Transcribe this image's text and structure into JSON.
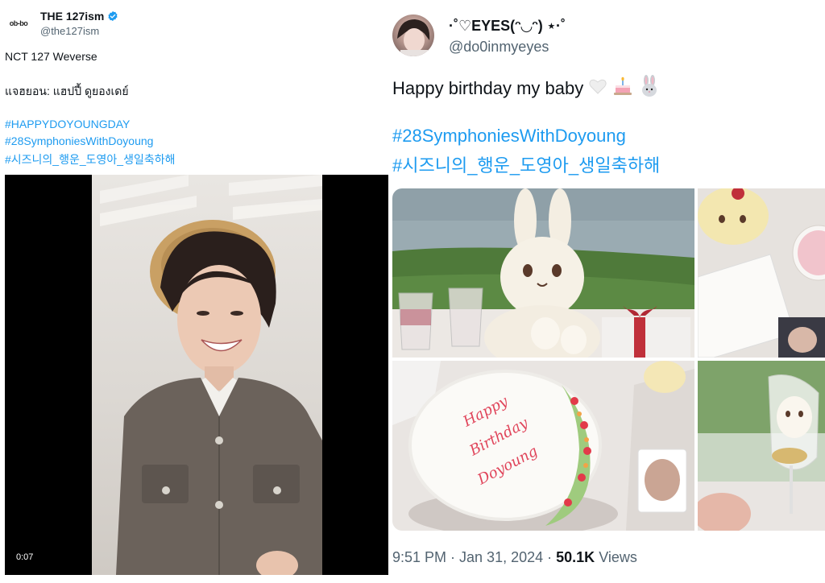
{
  "left_tweet": {
    "account_name": "THE 127ism",
    "handle": "@the127ism",
    "avatar_text": "ob-bo",
    "lines": [
      "NCT 127 Weverse",
      "แจฮยอน: แฮปปี้ ดูยองเดย์"
    ],
    "hashtags": [
      "#HAPPYDOYOUNGDAY",
      "#28SymphoniesWithDoyoung",
      "#시즈니의_행운_도영아_생일축하해"
    ],
    "video_time": "0:07"
  },
  "right_tweet": {
    "display_name": "·˚♡EYES(ᵔ◡ᵔ) ⋆·˚",
    "handle": "@do0inmyeyes",
    "text": "Happy birthday my baby",
    "emojis": [
      "heart-icon",
      "cake-icon",
      "rabbit-icon"
    ],
    "hashtags": [
      "#28SymphoniesWithDoyoung",
      "#시즈니의_행운_도영아_생일축하해"
    ],
    "cake_writing": [
      "Happy",
      "Birthday",
      "Doyoung"
    ],
    "timestamp": "9:51 PM · Jan 31, 2024 ·",
    "views_count": "50.1K",
    "views_label": "Views"
  },
  "colors": {
    "link": "#1d9bf0",
    "muted": "#536471",
    "verified": "#1d9bf0"
  }
}
